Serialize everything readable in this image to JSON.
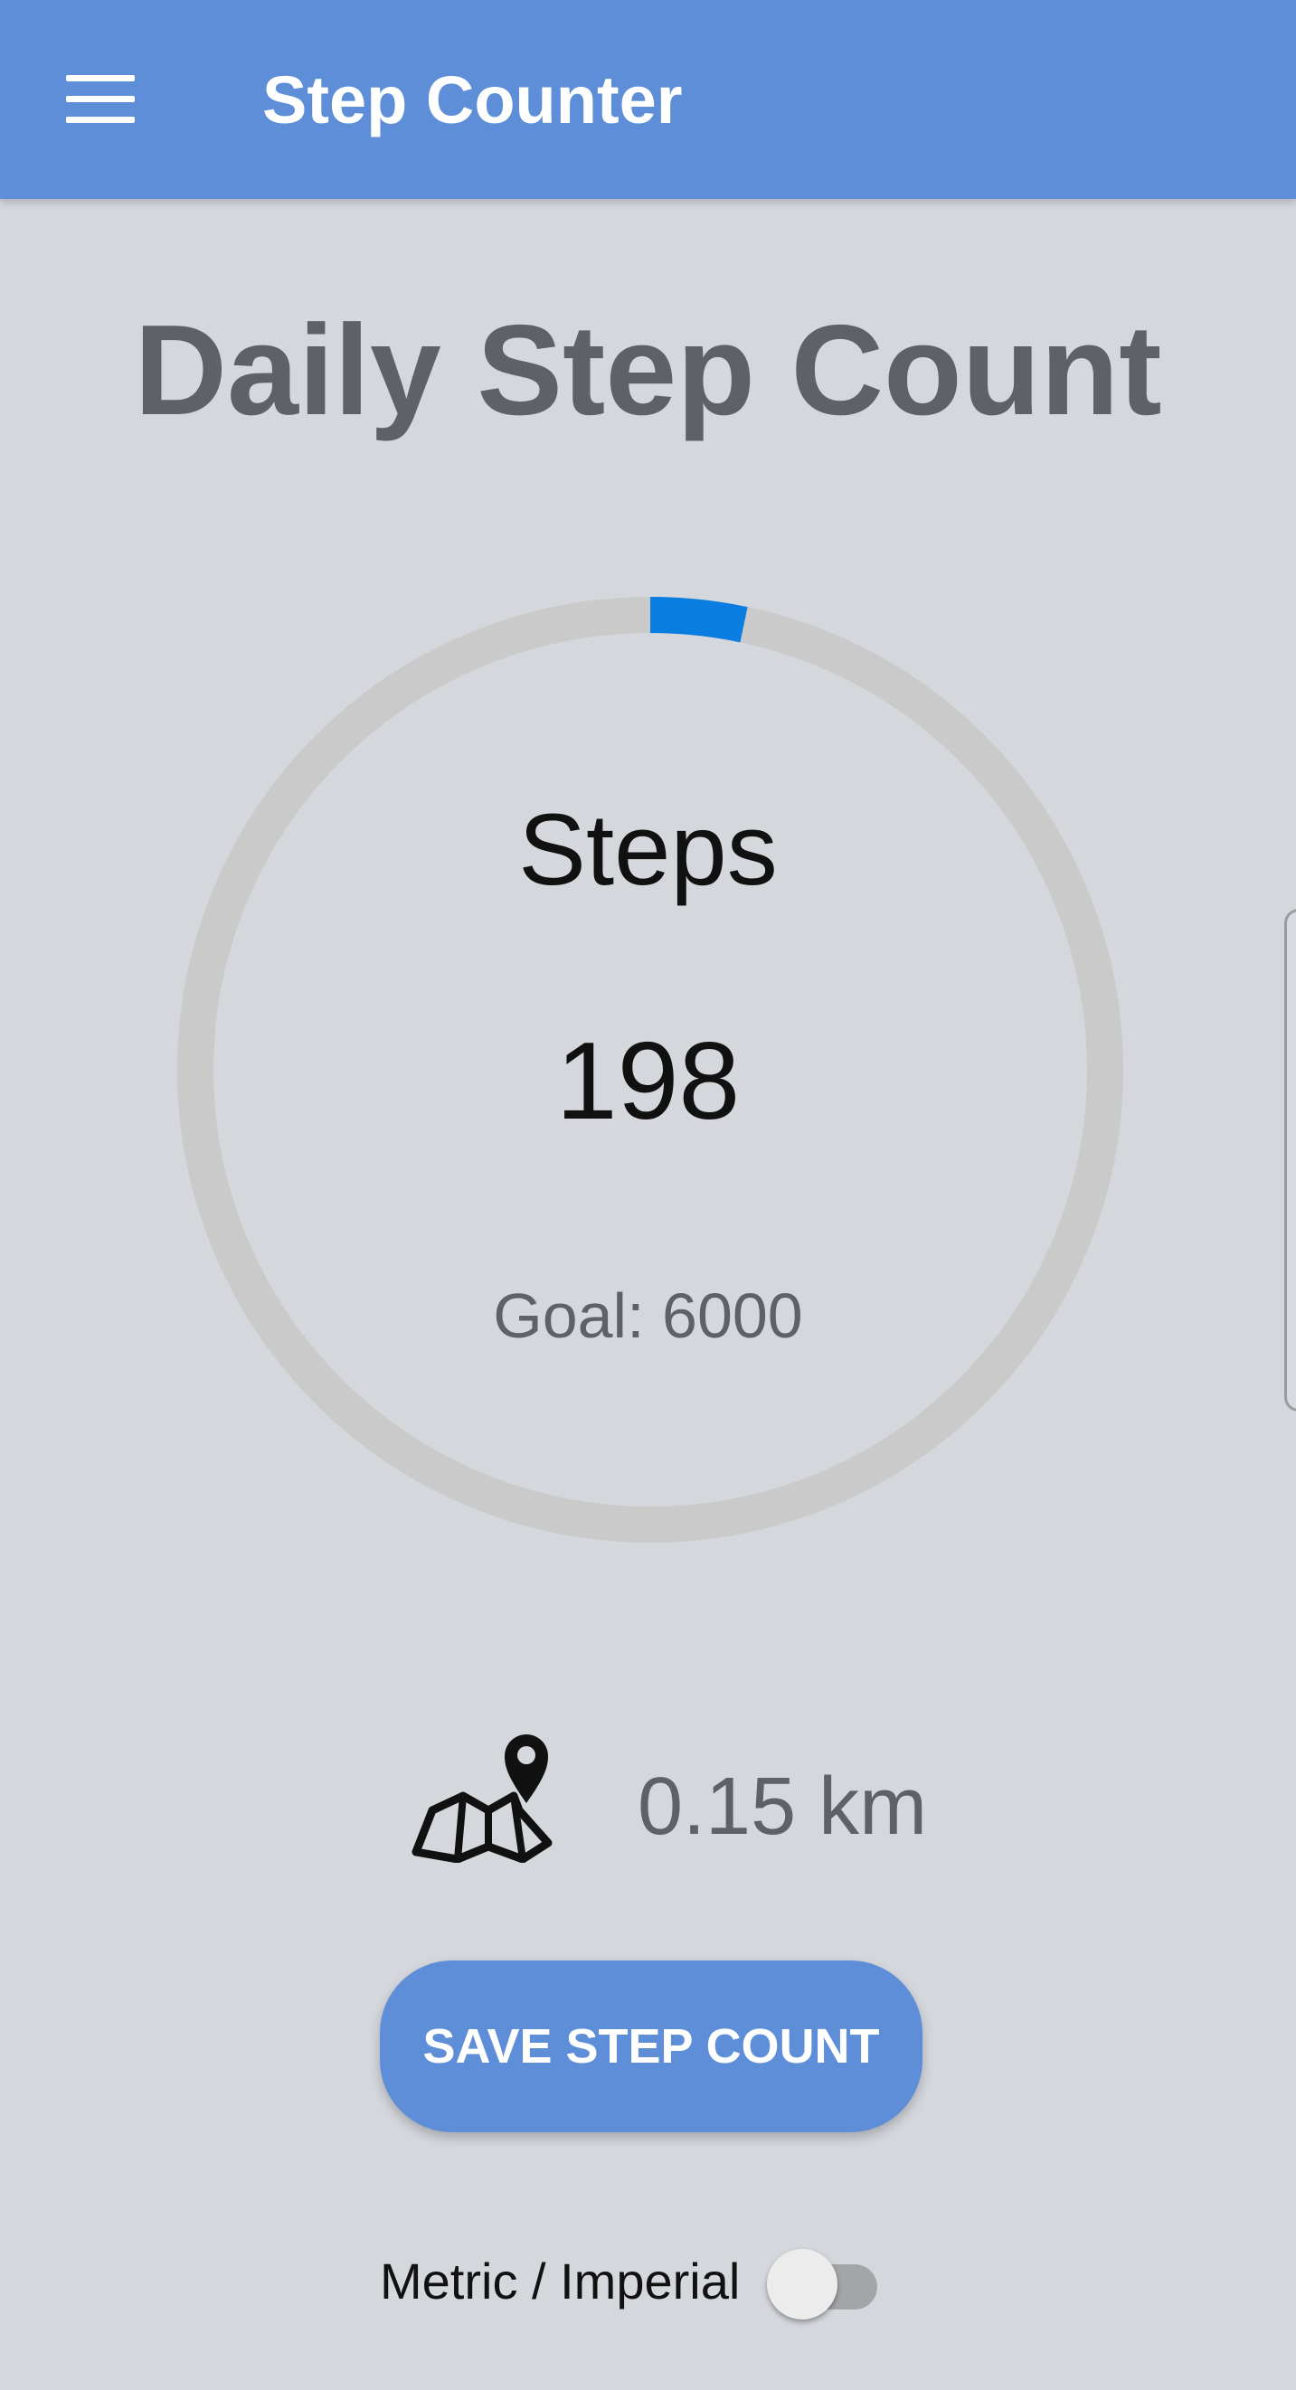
{
  "app_bar": {
    "title": "Step Counter",
    "menu_icon": "hamburger-menu-icon"
  },
  "page": {
    "title": "Daily Step Count"
  },
  "progress": {
    "label": "Steps",
    "steps": "198",
    "goal_text": "Goal: 6000",
    "steps_value": 198,
    "goal_value": 6000,
    "fraction": 0.033
  },
  "distance": {
    "icon": "map-location-icon",
    "value": "0.15 km"
  },
  "actions": {
    "save_label": "SAVE STEP COUNT"
  },
  "units": {
    "label": "Metric / Imperial",
    "toggle_on": false
  },
  "colors": {
    "app_bar": "#5e8ed8",
    "background": "#d4d7dc",
    "progress_arc": "#0a7de0",
    "ring_track": "#cacaca",
    "muted_text": "#5f6166"
  }
}
